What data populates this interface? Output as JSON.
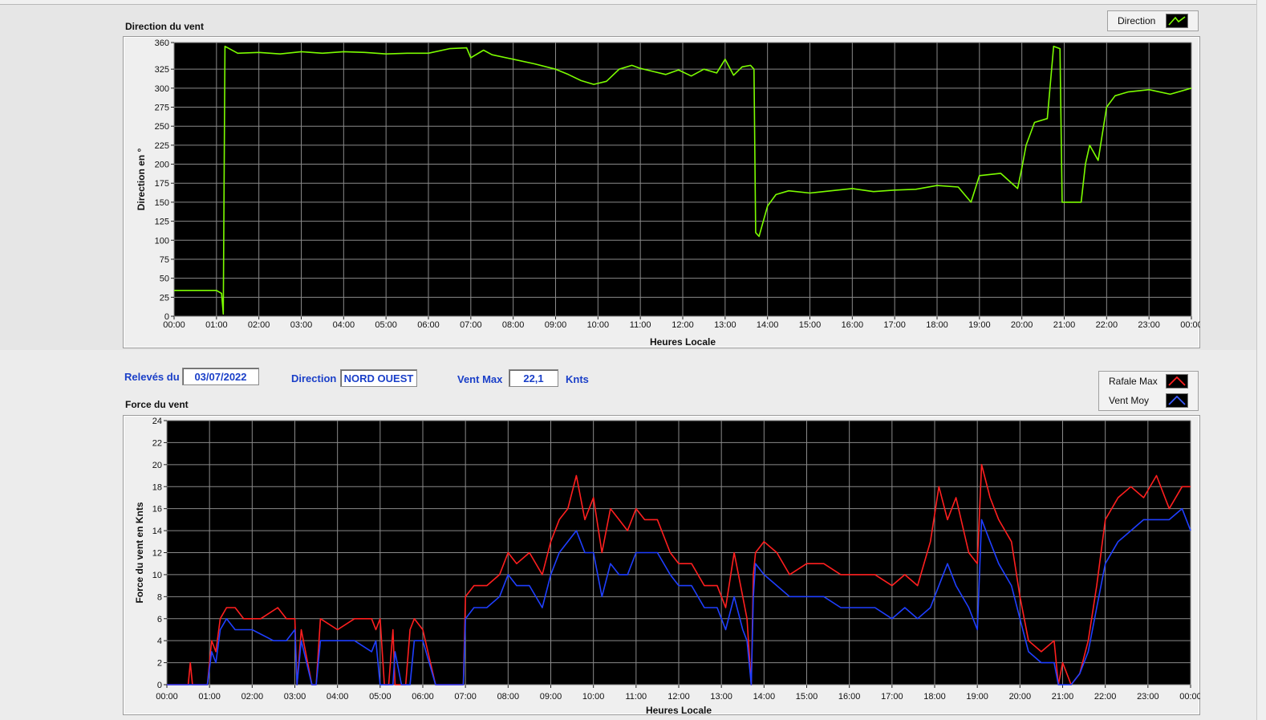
{
  "colors": {
    "direction": "#7CFC00",
    "gust": "#ff1f1f",
    "mean": "#1f3fff",
    "label_blue": "#1a3fc8"
  },
  "info": {
    "releves_label": "Relevés du",
    "releves_value": "03/07/2022",
    "direction_label": "Direction",
    "direction_value": "NORD OUEST",
    "ventmax_label": "Vent Max",
    "ventmax_value": "22,1",
    "ventmax_unit": "Knts"
  },
  "chart_data": [
    {
      "type": "line",
      "title": "Direction du vent",
      "xlabel": "Heures Locale",
      "ylabel": "Direction en °",
      "ylim": [
        0,
        360
      ],
      "xlim": [
        0,
        24
      ],
      "x_ticks": [
        "00:00",
        "01:00",
        "02:00",
        "03:00",
        "04:00",
        "05:00",
        "06:00",
        "07:00",
        "08:00",
        "09:00",
        "10:00",
        "11:00",
        "12:00",
        "13:00",
        "14:00",
        "15:00",
        "16:00",
        "17:00",
        "18:00",
        "19:00",
        "20:00",
        "21:00",
        "22:00",
        "23:00",
        "00:00"
      ],
      "y_ticks": [
        0,
        25,
        50,
        75,
        100,
        125,
        150,
        175,
        200,
        225,
        250,
        275,
        300,
        325,
        360
      ],
      "grid": true,
      "legend_position": "top-right",
      "series": [
        {
          "name": "Direction",
          "x": [
            0,
            1.0,
            1.12,
            1.16,
            1.2,
            1.3,
            1.5,
            2,
            2.5,
            3,
            3.5,
            4,
            4.5,
            5,
            5.5,
            6,
            6.5,
            6.9,
            7,
            7.3,
            7.5,
            8,
            8.5,
            9,
            9.3,
            9.6,
            9.9,
            10.2,
            10.5,
            10.8,
            11,
            11.3,
            11.6,
            11.9,
            12.2,
            12.5,
            12.8,
            13.0,
            13.2,
            13.4,
            13.6,
            13.68,
            13.72,
            13.8,
            14.0,
            14.2,
            14.5,
            15,
            15.5,
            16,
            16.5,
            17,
            17.5,
            18,
            18.5,
            18.8,
            19,
            19.5,
            19.9,
            20.0,
            20.1,
            20.3,
            20.6,
            20.75,
            20.9,
            20.95,
            21.0,
            21.1,
            21.4,
            21.5,
            21.6,
            21.8,
            22.0,
            22.2,
            22.5,
            23,
            23.5,
            24
          ],
          "y": [
            34,
            34,
            30,
            3,
            355,
            352,
            346,
            347,
            345,
            348,
            346,
            348,
            347,
            345,
            346,
            346,
            352,
            353,
            340,
            350,
            344,
            338,
            332,
            325,
            318,
            310,
            305,
            309,
            325,
            330,
            326,
            322,
            318,
            324,
            316,
            325,
            320,
            338,
            317,
            328,
            330,
            325,
            110,
            105,
            145,
            160,
            165,
            162,
            165,
            168,
            164,
            166,
            167,
            172,
            170,
            150,
            185,
            188,
            168,
            195,
            225,
            255,
            260,
            355,
            352,
            150,
            150,
            150,
            150,
            200,
            225,
            205,
            275,
            290,
            295,
            298,
            292,
            300
          ]
        }
      ]
    },
    {
      "type": "line",
      "title": "Force du vent",
      "xlabel": "Heures Locale",
      "ylabel": "Force du vent en Knts",
      "ylim": [
        0,
        24
      ],
      "xlim": [
        0,
        24
      ],
      "x_ticks": [
        "00:00",
        "01:00",
        "02:00",
        "03:00",
        "04:00",
        "05:00",
        "06:00",
        "07:00",
        "08:00",
        "09:00",
        "10:00",
        "11:00",
        "12:00",
        "13:00",
        "14:00",
        "15:00",
        "16:00",
        "17:00",
        "18:00",
        "19:00",
        "20:00",
        "21:00",
        "22:00",
        "23:00",
        "00:00"
      ],
      "y_ticks": [
        0,
        2,
        4,
        6,
        8,
        10,
        12,
        14,
        16,
        18,
        20,
        22,
        24
      ],
      "grid": true,
      "legend_position": "top-right",
      "series": [
        {
          "name": "Rafale Max",
          "x": [
            0,
            0.5,
            0.55,
            0.6,
            0.95,
            1.05,
            1.15,
            1.25,
            1.4,
            1.6,
            1.8,
            2.2,
            2.6,
            2.8,
            3.0,
            3.05,
            3.15,
            3.4,
            3.5,
            3.6,
            4.0,
            4.4,
            4.8,
            4.9,
            5.0,
            5.1,
            5.2,
            5.3,
            5.35,
            5.5,
            5.6,
            5.7,
            5.8,
            6.0,
            6.3,
            6.7,
            6.95,
            7.0,
            7.2,
            7.5,
            7.8,
            8.0,
            8.2,
            8.5,
            8.8,
            9.0,
            9.2,
            9.4,
            9.6,
            9.8,
            10.0,
            10.2,
            10.4,
            10.6,
            10.8,
            11.0,
            11.2,
            11.5,
            11.8,
            12.0,
            12.3,
            12.6,
            12.9,
            13.1,
            13.3,
            13.5,
            13.6,
            13.7,
            13.75,
            13.8,
            14.0,
            14.3,
            14.6,
            15.0,
            15.4,
            15.8,
            16.2,
            16.6,
            17.0,
            17.3,
            17.6,
            17.9,
            18.1,
            18.3,
            18.5,
            18.8,
            19.0,
            19.1,
            19.3,
            19.5,
            19.8,
            20.0,
            20.2,
            20.5,
            20.8,
            20.9,
            21.0,
            21.2,
            21.4,
            21.6,
            21.8,
            22.0,
            22.3,
            22.6,
            22.9,
            23.2,
            23.5,
            23.8,
            24.0
          ],
          "y": [
            0,
            0,
            2,
            0,
            0,
            4,
            3,
            6,
            7,
            7,
            6,
            6,
            7,
            6,
            6,
            0,
            5,
            0,
            0,
            6,
            5,
            6,
            6,
            5,
            6,
            0,
            0,
            5,
            0,
            0,
            0,
            5,
            6,
            5,
            0,
            0,
            0,
            8,
            9,
            9,
            10,
            12,
            11,
            12,
            10,
            13,
            15,
            16,
            19,
            15,
            17,
            12,
            16,
            15,
            14,
            16,
            15,
            15,
            12,
            11,
            11,
            9,
            9,
            7,
            12,
            8,
            6,
            0,
            10,
            12,
            13,
            12,
            10,
            11,
            11,
            10,
            10,
            10,
            9,
            10,
            9,
            13,
            18,
            15,
            17,
            12,
            11,
            20,
            17,
            15,
            13,
            8,
            4,
            3,
            4,
            0,
            2,
            0,
            1,
            4,
            9,
            15,
            17,
            18,
            17,
            19,
            16,
            18,
            18
          ]
        },
        {
          "name": "Vent Moy",
          "x": [
            0,
            0.95,
            1.05,
            1.15,
            1.25,
            1.4,
            1.6,
            2.0,
            2.5,
            2.8,
            3.0,
            3.05,
            3.15,
            3.4,
            3.5,
            3.6,
            4.0,
            4.4,
            4.8,
            4.9,
            5.0,
            5.1,
            5.3,
            5.35,
            5.5,
            5.6,
            5.7,
            5.8,
            6.0,
            6.3,
            6.7,
            6.95,
            7.0,
            7.2,
            7.5,
            7.8,
            8.0,
            8.2,
            8.5,
            8.8,
            9.0,
            9.2,
            9.4,
            9.6,
            9.8,
            10.0,
            10.2,
            10.4,
            10.6,
            10.8,
            11.0,
            11.2,
            11.5,
            11.8,
            12.0,
            12.3,
            12.6,
            12.9,
            13.1,
            13.3,
            13.5,
            13.6,
            13.7,
            13.75,
            13.8,
            14.0,
            14.3,
            14.6,
            15.0,
            15.4,
            15.8,
            16.2,
            16.6,
            17.0,
            17.3,
            17.6,
            17.9,
            18.1,
            18.3,
            18.5,
            18.8,
            19.0,
            19.1,
            19.3,
            19.5,
            19.8,
            20.0,
            20.2,
            20.5,
            20.8,
            20.9,
            21.0,
            21.2,
            21.4,
            21.6,
            21.8,
            22.0,
            22.3,
            22.6,
            22.9,
            23.2,
            23.5,
            23.8,
            24.0
          ],
          "y": [
            0,
            0,
            3,
            2,
            5,
            6,
            5,
            5,
            4,
            4,
            5,
            0,
            4,
            0,
            0,
            4,
            4,
            4,
            3,
            4,
            0,
            0,
            0,
            3,
            0,
            0,
            0,
            4,
            4,
            0,
            0,
            0,
            6,
            7,
            7,
            8,
            10,
            9,
            9,
            7,
            10,
            12,
            13,
            14,
            12,
            12,
            8,
            11,
            10,
            10,
            12,
            12,
            12,
            10,
            9,
            9,
            7,
            7,
            5,
            8,
            5,
            4,
            0,
            8,
            11,
            10,
            9,
            8,
            8,
            8,
            7,
            7,
            7,
            6,
            7,
            6,
            7,
            9,
            11,
            9,
            7,
            5,
            15,
            13,
            11,
            9,
            6,
            3,
            2,
            2,
            0,
            0,
            0,
            1,
            3,
            7,
            11,
            13,
            14,
            15,
            15,
            15,
            16,
            14
          ]
        }
      ]
    }
  ]
}
